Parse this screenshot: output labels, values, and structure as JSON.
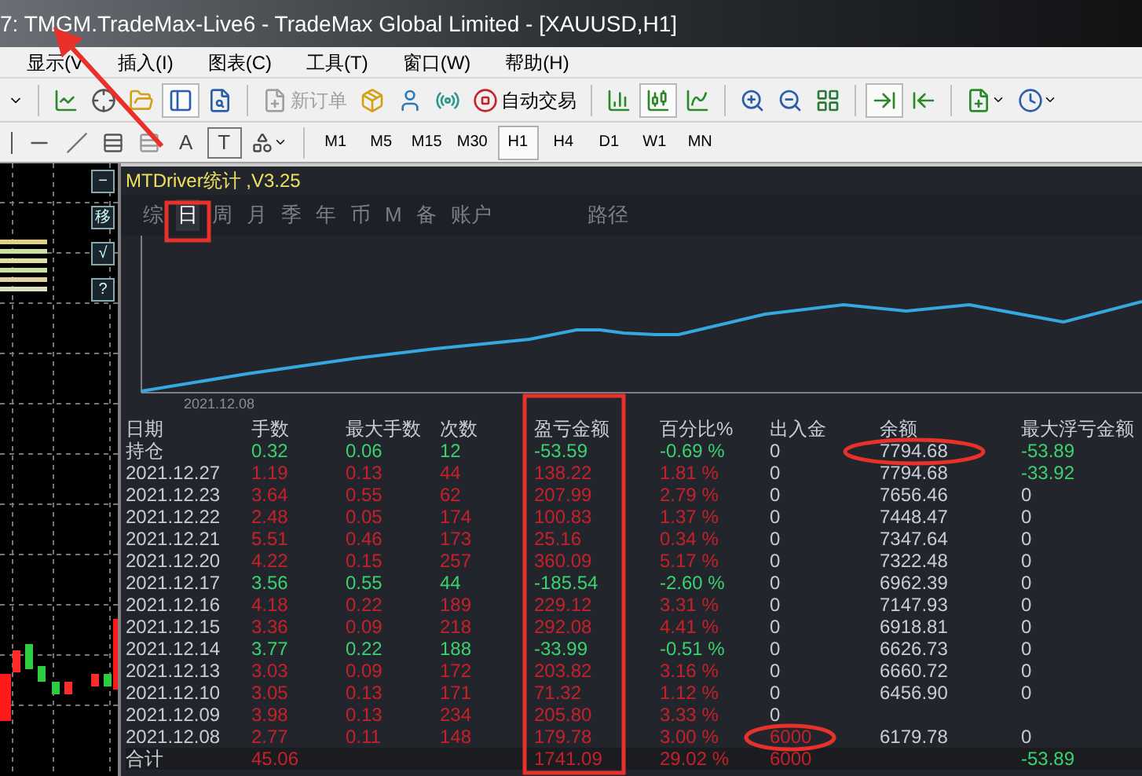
{
  "window": {
    "title": "7: TMGM.TradeMax-Live6 - TradeMax Global Limited - [XAUUSD,H1]"
  },
  "menu": [
    "显示(V",
    "插入(I)",
    "图表(C)",
    "工具(T)",
    "窗口(W)",
    "帮助(H)"
  ],
  "toolbar": {
    "new_order": {
      "label": "新订单",
      "disabled": true
    },
    "auto_trading": {
      "label": "自动交易"
    }
  },
  "drawing_toolbar": {
    "text_tools": [
      "A",
      "T"
    ],
    "timeframes": [
      {
        "label": "M1",
        "selected": false
      },
      {
        "label": "M5",
        "selected": false
      },
      {
        "label": "M15",
        "selected": false
      },
      {
        "label": "M30",
        "selected": false
      },
      {
        "label": "H1",
        "selected": true
      },
      {
        "label": "H4",
        "selected": false
      },
      {
        "label": "D1",
        "selected": false
      },
      {
        "label": "W1",
        "selected": false
      },
      {
        "label": "MN",
        "selected": false
      }
    ]
  },
  "chart_side_buttons": [
    "−",
    "移",
    "√",
    "?"
  ],
  "panel": {
    "title": "MTDriver统计 ,V3.25",
    "tabs": [
      {
        "label": "综",
        "selected": false
      },
      {
        "label": "日",
        "selected": true
      },
      {
        "label": "周",
        "selected": false
      },
      {
        "label": "月",
        "selected": false
      },
      {
        "label": "季",
        "selected": false
      },
      {
        "label": "年",
        "selected": false
      },
      {
        "label": "币",
        "selected": false
      },
      {
        "label": "M",
        "selected": false
      },
      {
        "label": "备",
        "selected": false
      },
      {
        "label": "账户",
        "selected": false
      },
      {
        "label": "路径",
        "selected": false
      }
    ],
    "equity_chart": {
      "start_label": "2021.12.08"
    },
    "table": {
      "columns": [
        "日期",
        "手数",
        "最大手数",
        "次数",
        "盈亏金额",
        "百分比%",
        "出入金",
        "余额",
        "最大浮亏金额"
      ],
      "rows": [
        {
          "date": "持仓",
          "lots": "0.32",
          "max_lots": "0.06",
          "trades": "12",
          "profit": "-53.59",
          "percent": "-0.69 %",
          "deposit": "0",
          "balance": "7794.68",
          "max_float": "-53.89",
          "loss": true,
          "deposit_active": false,
          "float_active": true
        },
        {
          "date": "2021.12.27",
          "lots": "1.19",
          "max_lots": "0.13",
          "trades": "44",
          "profit": "138.22",
          "percent": "1.81 %",
          "deposit": "0",
          "balance": "7794.68",
          "max_float": "-33.92",
          "loss": false,
          "deposit_active": false,
          "float_active": true
        },
        {
          "date": "2021.12.23",
          "lots": "3.64",
          "max_lots": "0.55",
          "trades": "62",
          "profit": "207.99",
          "percent": "2.79 %",
          "deposit": "0",
          "balance": "7656.46",
          "max_float": "0",
          "loss": false,
          "deposit_active": false,
          "float_active": false
        },
        {
          "date": "2021.12.22",
          "lots": "2.48",
          "max_lots": "0.05",
          "trades": "174",
          "profit": "100.83",
          "percent": "1.37 %",
          "deposit": "0",
          "balance": "7448.47",
          "max_float": "0",
          "loss": false,
          "deposit_active": false,
          "float_active": false
        },
        {
          "date": "2021.12.21",
          "lots": "5.51",
          "max_lots": "0.46",
          "trades": "173",
          "profit": "25.16",
          "percent": "0.34 %",
          "deposit": "0",
          "balance": "7347.64",
          "max_float": "0",
          "loss": false,
          "deposit_active": false,
          "float_active": false
        },
        {
          "date": "2021.12.20",
          "lots": "4.22",
          "max_lots": "0.15",
          "trades": "257",
          "profit": "360.09",
          "percent": "5.17 %",
          "deposit": "0",
          "balance": "7322.48",
          "max_float": "0",
          "loss": false,
          "deposit_active": false,
          "float_active": false
        },
        {
          "date": "2021.12.17",
          "lots": "3.56",
          "max_lots": "0.55",
          "trades": "44",
          "profit": "-185.54",
          "percent": "-2.60 %",
          "deposit": "0",
          "balance": "6962.39",
          "max_float": "0",
          "loss": true,
          "deposit_active": false,
          "float_active": false
        },
        {
          "date": "2021.12.16",
          "lots": "4.18",
          "max_lots": "0.22",
          "trades": "189",
          "profit": "229.12",
          "percent": "3.31 %",
          "deposit": "0",
          "balance": "7147.93",
          "max_float": "0",
          "loss": false,
          "deposit_active": false,
          "float_active": false
        },
        {
          "date": "2021.12.15",
          "lots": "3.36",
          "max_lots": "0.09",
          "trades": "218",
          "profit": "292.08",
          "percent": "4.41 %",
          "deposit": "0",
          "balance": "6918.81",
          "max_float": "0",
          "loss": false,
          "deposit_active": false,
          "float_active": false
        },
        {
          "date": "2021.12.14",
          "lots": "3.77",
          "max_lots": "0.22",
          "trades": "188",
          "profit": "-33.99",
          "percent": "-0.51 %",
          "deposit": "0",
          "balance": "6626.73",
          "max_float": "0",
          "loss": true,
          "deposit_active": false,
          "float_active": false
        },
        {
          "date": "2021.12.13",
          "lots": "3.03",
          "max_lots": "0.09",
          "trades": "172",
          "profit": "203.82",
          "percent": "3.16 %",
          "deposit": "0",
          "balance": "6660.72",
          "max_float": "0",
          "loss": false,
          "deposit_active": false,
          "float_active": false
        },
        {
          "date": "2021.12.10",
          "lots": "3.05",
          "max_lots": "0.13",
          "trades": "171",
          "profit": "71.32",
          "percent": "1.12 %",
          "deposit": "0",
          "balance": "6456.90",
          "max_float": "0",
          "loss": false,
          "deposit_active": false,
          "float_active": false
        },
        {
          "date": "2021.12.09",
          "lots": "3.98",
          "max_lots": "0.13",
          "trades": "234",
          "profit": "205.80",
          "percent": "3.33 %",
          "deposit": "0",
          "loss": false,
          "deposit_active": false
        },
        {
          "date": "2021.12.08",
          "lots": "2.77",
          "max_lots": "0.11",
          "trades": "148",
          "profit": "179.78",
          "percent": "3.00 %",
          "deposit": "6000",
          "balance": "6179.78",
          "max_float": "0",
          "loss": false,
          "deposit_active": true,
          "float_active": false
        }
      ],
      "total": {
        "label": "合计",
        "lots": "45.06",
        "profit": "1741.09",
        "percent": "29.02 %",
        "deposit": "6000",
        "max_float": "-53.89"
      }
    }
  }
}
